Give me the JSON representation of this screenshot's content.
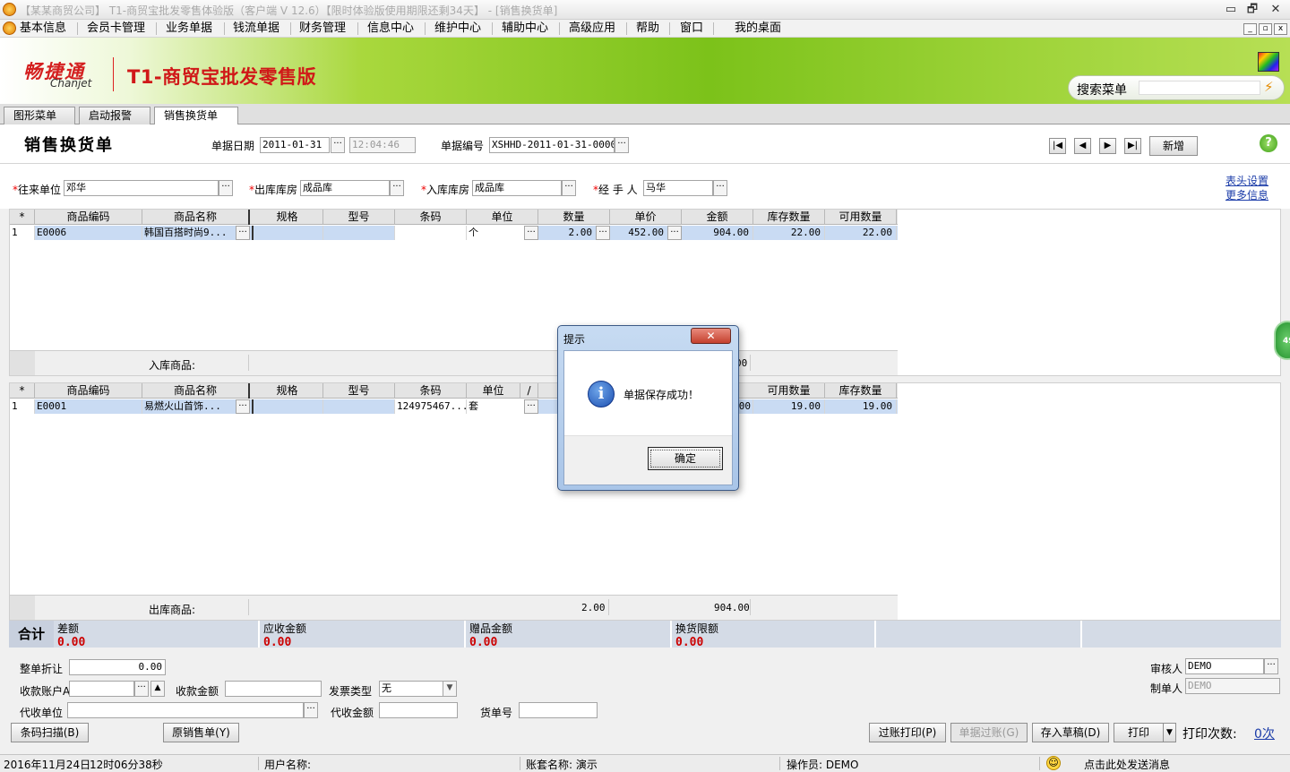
{
  "window": {
    "title": "【某某商贸公司】 T1-商贸宝批发零售体验版（客户端 V 12.6）【限时体验版使用期限还剩34天】 - [销售换货单]",
    "minimize": "▭",
    "restore": "🗗",
    "close": "✕"
  },
  "menu": {
    "items": [
      "基本信息",
      "会员卡管理",
      "业务单据",
      "钱流单据",
      "财务管理",
      "信息中心",
      "维护中心",
      "辅助中心",
      "高级应用",
      "帮助",
      "窗口",
      "我的桌面"
    ]
  },
  "banner": {
    "logo_cn": "畅捷通",
    "logo_en": "Chanjet",
    "product": "T1-商贸宝批发零售版",
    "search_label": "搜索菜单"
  },
  "tabs": [
    "图形菜单",
    "启动报警",
    "销售换货单"
  ],
  "form": {
    "title": "销售换货单",
    "date_label": "单据日期",
    "date_value": "2011-01-31",
    "time_value": "12:04:46",
    "docno_label": "单据编号",
    "docno_value": "XSHHD-2011-01-31-00001",
    "new_button": "新增",
    "partner_label": "往来单位",
    "partner_value": "邓华",
    "out_wh_label": "出库库房",
    "out_wh_value": "成品库",
    "in_wh_label": "入库库房",
    "in_wh_value": "成品库",
    "handler_label": "经 手 人",
    "handler_value": "马华",
    "header_settings": "表头设置",
    "more_info": "更多信息"
  },
  "grid_in": {
    "headers": [
      "*",
      "商品编码",
      "商品名称",
      "规格",
      "型号",
      "条码",
      "单位",
      "数量",
      "单价",
      "金额",
      "库存数量",
      "可用数量"
    ],
    "rows": [
      {
        "no": "1",
        "code": "E0006",
        "name": "韩国百搭时尚9...",
        "spec": "",
        "model": "",
        "barcode": "",
        "unit": "个",
        "qty": "2.00",
        "price": "452.00",
        "amount": "904.00",
        "stock": "22.00",
        "avail": "22.00"
      }
    ],
    "summary_label": "入库商品:",
    "summary_amount": "00"
  },
  "grid_out": {
    "headers": [
      "*",
      "商品编码",
      "商品名称",
      "规格",
      "型号",
      "条码",
      "单位",
      "/",
      "可用数量",
      "库存数量"
    ],
    "rows": [
      {
        "no": "1",
        "code": "E0001",
        "name": "易燃火山首饰...",
        "spec": "",
        "model": "",
        "barcode": "124975467...",
        "unit": "套",
        "amount_tail": "00",
        "avail": "19.00",
        "stock": "19.00"
      }
    ],
    "summary_label": "出库商品:",
    "summary_qty": "2.00",
    "summary_amount": "904.00"
  },
  "totals": {
    "label": "合计",
    "items": [
      {
        "label": "差额",
        "value": "0.00"
      },
      {
        "label": "应收金额",
        "value": "0.00"
      },
      {
        "label": "赠品金额",
        "value": "0.00"
      },
      {
        "label": "换货限额",
        "value": "0.00"
      }
    ]
  },
  "footer": {
    "discount_label": "整单折让",
    "discount_value": "0.00",
    "account_label": "收款账户A",
    "receive_label": "收款金额",
    "invoice_label": "发票类型",
    "invoice_value": "无",
    "agent_label": "代收单位",
    "agent_amount_label": "代收金额",
    "waybill_label": "货单号",
    "auditor_label": "审核人",
    "auditor_value": "DEMO",
    "maker_label": "制单人",
    "maker_value": "DEMO",
    "scan_button": "条码扫描(B)",
    "orig_button": "原销售单(Y)",
    "post_print_button": "过账打印(P)",
    "post_button": "单据过账(G)",
    "draft_button": "存入草稿(D)",
    "print_button": "打印",
    "print_count_label": "打印次数:",
    "print_count_value": "0次"
  },
  "dialog": {
    "title": "提示",
    "message": "单据保存成功！",
    "ok": "确定",
    "close": "✕"
  },
  "status": {
    "date": "2016年11月24日",
    "time": "12时06分38秒",
    "user": "用户名称:",
    "account": "账套名称: 演示",
    "operator": "操作员: DEMO",
    "send_msg": "点击此处发送消息",
    "badge": "49"
  },
  "colors": {
    "banner_green": "#7cc21a",
    "brand_red": "#d42020",
    "selected_row": "#c9dbf3",
    "total_red": "#cc0000"
  }
}
